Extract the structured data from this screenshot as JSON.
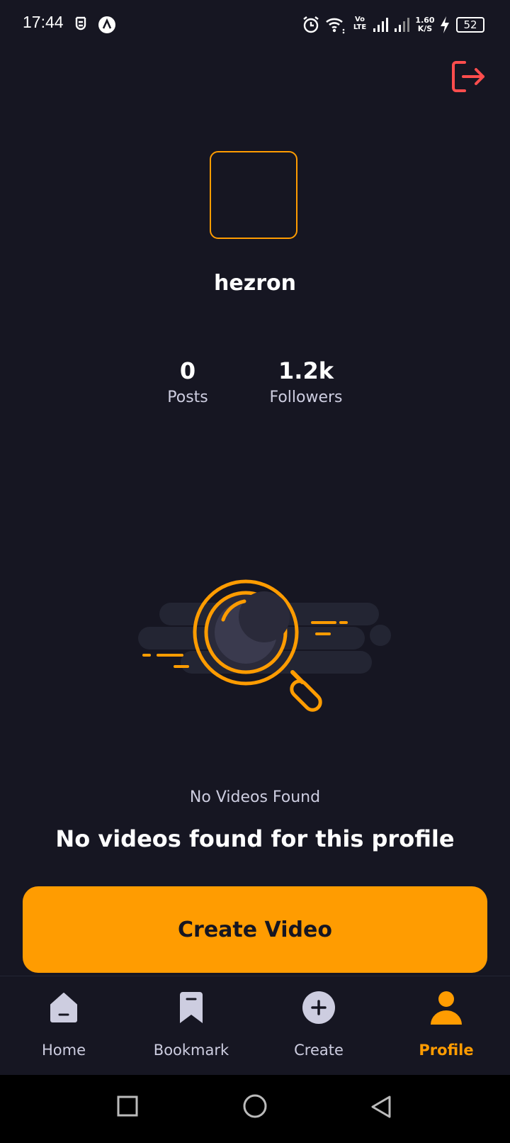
{
  "status_bar": {
    "time": "17:44",
    "network_speed_top": "1.60",
    "network_speed_bottom": "K/S",
    "volte_top": "Vo",
    "volte_bottom": "LTE",
    "battery": "52",
    "icons": [
      "shield-icon",
      "a-app-icon",
      "alarm-icon",
      "wifi-icon",
      "volte-icon",
      "signal-icon",
      "signal-icon",
      "charging-icon",
      "battery-icon"
    ]
  },
  "header": {
    "logout_icon": "logout-icon"
  },
  "profile": {
    "username": "hezron",
    "stats": [
      {
        "value": "0",
        "label": "Posts"
      },
      {
        "value": "1.2k",
        "label": "Followers"
      }
    ]
  },
  "empty_state": {
    "icon": "search-magnifier-illustration",
    "title": "No Videos Found",
    "subtitle": "No videos found for this profile",
    "button_label": "Create Video"
  },
  "tabs": [
    {
      "label": "Home",
      "icon": "home-icon",
      "active": false
    },
    {
      "label": "Bookmark",
      "icon": "bookmark-icon",
      "active": false
    },
    {
      "label": "Create",
      "icon": "plus-icon",
      "active": false
    },
    {
      "label": "Profile",
      "icon": "profile-icon",
      "active": true
    }
  ],
  "colors": {
    "background": "#161622",
    "accent": "#FF9C01",
    "muted_text": "#CDCDE0",
    "logout": "#FF4D4D"
  }
}
